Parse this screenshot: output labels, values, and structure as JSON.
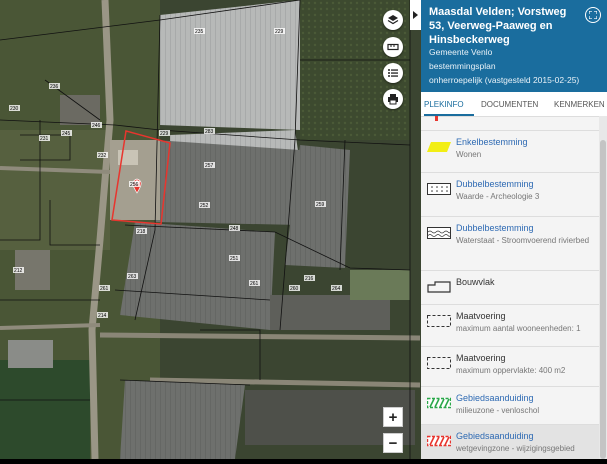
{
  "map": {
    "parcel_labels": [
      "235",
      "229",
      "236",
      "231",
      "245",
      "246",
      "232",
      "230",
      "283",
      "256",
      "257",
      "252",
      "259",
      "251",
      "261",
      "260",
      "264",
      "263",
      "218",
      "214",
      "212",
      "216",
      "248",
      "229",
      "261"
    ],
    "controls": {
      "layers_icon": "layers-icon",
      "measure_icon": "ruler-icon",
      "legend_icon": "list-icon",
      "print_icon": "print-icon"
    },
    "zoom_in": "+",
    "zoom_out": "−",
    "fullscreen_icon": "fullscreen-icon",
    "collapse_icon": "chevron-right-icon",
    "marker_icon": "map-pin-icon",
    "accent_color": "#e8352e"
  },
  "panel": {
    "title": "Maasdal Velden; Vorstweg 53, Veerweg-Paaweg en Hinsbeckerweg",
    "municipality": "Gemeente Venlo",
    "type": "bestemmingsplan",
    "status": "onherroepelijk (vastgesteld 2015-02-25)",
    "close_icon": "close-icon",
    "header_color": "#1a6d9e",
    "tabs": [
      "PLEKINFO",
      "DOCUMENTEN",
      "KENMERKEN"
    ],
    "active_tab": "PLEKINFO",
    "items": [
      {
        "title": "Enkelbestemming",
        "subtitle": "Wonen",
        "symbol": "yellow-parallelogram"
      },
      {
        "title": "Dubbelbestemming",
        "subtitle": "Waarde - Archeologie 3",
        "symbol": "dotted-box"
      },
      {
        "title": "Dubbelbestemming",
        "subtitle": "Waterstaat - Stroomvoerend rivierbed",
        "symbol": "wave-box"
      },
      {
        "title": "Bouwvlak",
        "subtitle": "",
        "symbol": "building-outline"
      },
      {
        "title": "Maatvoering",
        "subtitle": "maximum aantal wooneenheden: 1",
        "symbol": "dashed-box"
      },
      {
        "title": "Maatvoering",
        "subtitle": "maximum oppervlakte: 400 m2",
        "symbol": "dashed-box"
      },
      {
        "title": "Gebiedsaanduiding",
        "subtitle": "milieuzone - venloschol",
        "symbol": "green-hatch"
      },
      {
        "title": "Gebiedsaanduiding",
        "subtitle": "wetgevingzone - wijzigingsgebied",
        "symbol": "red-hatch"
      }
    ]
  }
}
